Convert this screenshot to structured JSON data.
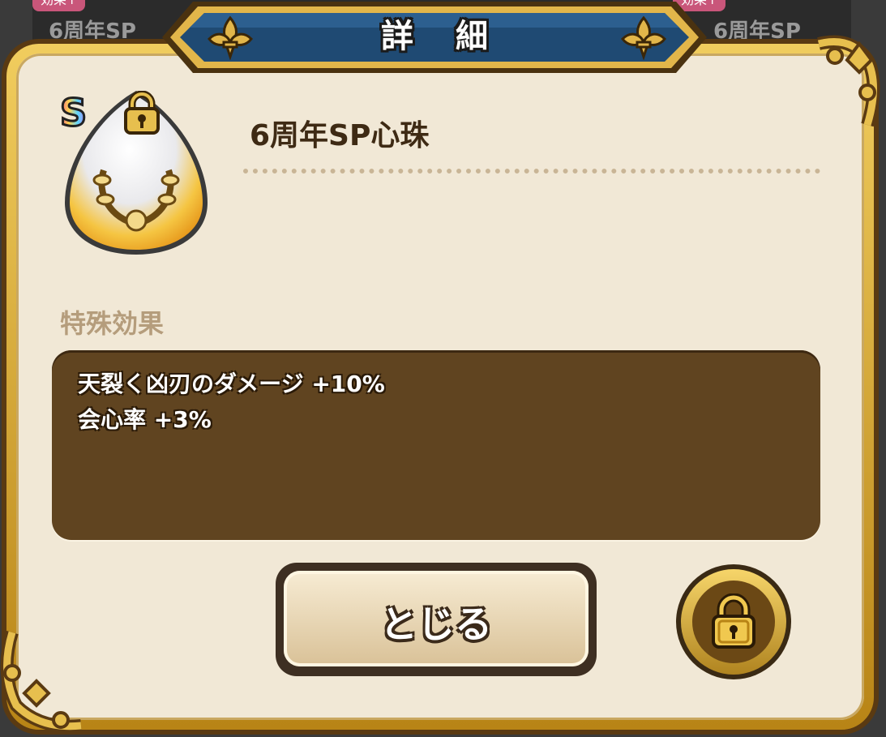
{
  "background": {
    "tag_left": "効果↑",
    "tag_right": "効果↑",
    "text_left": "6周年SP",
    "text_right": "6周年SP"
  },
  "dialog": {
    "title": "詳細",
    "item": {
      "rank": "S",
      "name": "6周年SP心珠",
      "icon": "laurel-orb-icon",
      "locked": true
    },
    "section_label": "特殊効果",
    "effects": [
      "天裂く凶刃のダメージ +10%",
      "会心率 +3%"
    ],
    "close_label": "とじる",
    "lock_button_icon": "lock-icon"
  },
  "colors": {
    "panel_bg": "#f1e8d6",
    "gold_frame": "#d9aa35",
    "banner_blue": "#1f4a73",
    "effects_bg": "#604420",
    "text_dark": "#3e2a14"
  }
}
